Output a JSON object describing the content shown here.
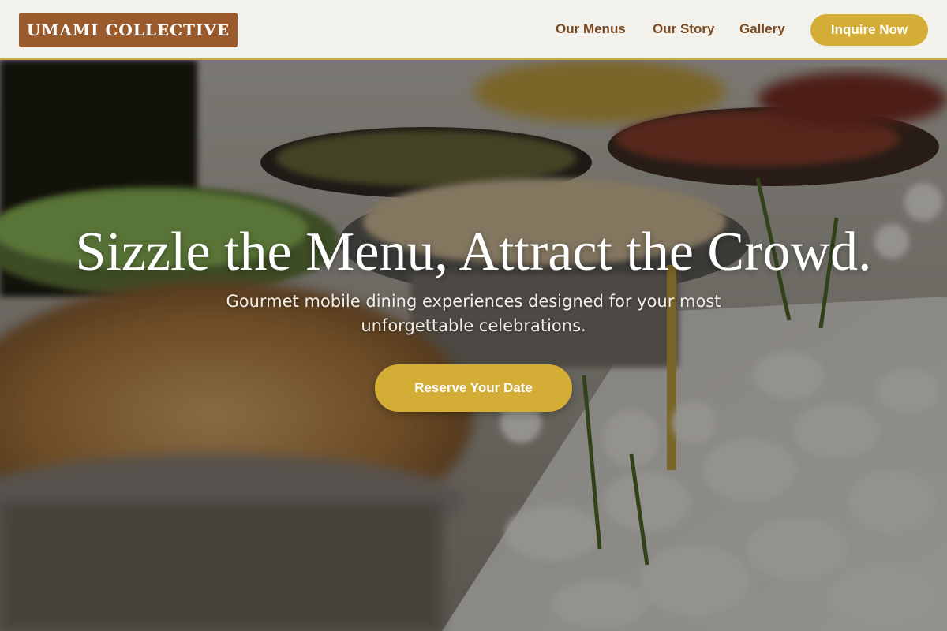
{
  "header": {
    "logo": "UMAMI COLLECTIVE",
    "nav": [
      {
        "label": "Our Menus"
      },
      {
        "label": "Our Story"
      },
      {
        "label": "Gallery"
      }
    ],
    "cta_label": "Inquire Now"
  },
  "hero": {
    "title": "Sizzle the Menu, Attract the Crowd.",
    "subtitle": "Gourmet mobile dining experiences designed for your most unforgettable celebrations.",
    "cta_label": "Reserve Your Date",
    "background_image": "catering-buffet-photo"
  },
  "colors": {
    "header_bg": "#f3f1ec",
    "logo_bg": "#9a5a2c",
    "nav_text": "#7d4a22",
    "accent_gold": "#d4ad37",
    "hero_text": "#ffffff"
  }
}
